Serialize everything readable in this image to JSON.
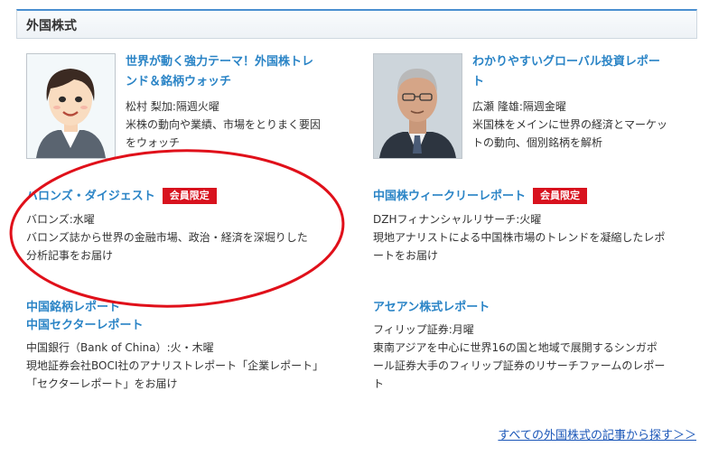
{
  "section": {
    "title": "外国株式"
  },
  "cards": [
    {
      "title_line1": "世界が動く強力テーマ！外国株トレ",
      "title_line2": "ンド＆銘柄ウォッチ",
      "author": "松村 梨加:隔週火曜",
      "desc_line1": "米株の動向や業績、市場をとりまく要因",
      "desc_line2": "をウォッチ"
    },
    {
      "title_line1": "わかりやすいグローバル投資レポー",
      "title_line2": "ト",
      "author": "広瀬 隆雄:隔週金曜",
      "desc_line1": "米国株をメインに世界の経済とマーケッ",
      "desc_line2": "トの動向、個別銘柄を解析"
    },
    {
      "title": "バロンズ・ダイジェスト",
      "badge": "会員限定",
      "author": "バロンズ:水曜",
      "desc_line1": "バロンズ誌から世界の金融市場、政治・経済を深堀りした",
      "desc_line2": "分析記事をお届け"
    },
    {
      "title": "中国株ウィークリーレポート",
      "badge": "会員限定",
      "author": "DZHフィナンシャルリサーチ:火曜",
      "desc_line1": "現地アナリストによる中国株市場のトレンドを凝縮したレポ",
      "desc_line2": "ートをお届け"
    },
    {
      "title_line1": "中国銘柄レポート",
      "title_line2": "中国セクターレポート",
      "author": "中国銀行（Bank of China）:火・木曜",
      "desc_line1": "現地証券会社BOCI社のアナリストレポート「企業レポート」",
      "desc_line2": "「セクターレポート」をお届け"
    },
    {
      "title": "アセアン株式レポート",
      "author": "フィリップ証券:月曜",
      "desc_line1": "東南アジアを中心に世界16の国と地域で展開するシンガポ",
      "desc_line2": "ール証券大手のフィリップ証券のリサーチファームのレポー",
      "desc_line3": "ト"
    }
  ],
  "more_link": "すべての外国株式の記事から探す＞＞",
  "colors": {
    "accent_blue": "#2a84c6",
    "badge_red": "#d8121e",
    "annotation_red": "#e0101a",
    "link_blue": "#1a56b8"
  },
  "icons": [
    "illustrated-woman-portrait",
    "man-photo-portrait"
  ]
}
